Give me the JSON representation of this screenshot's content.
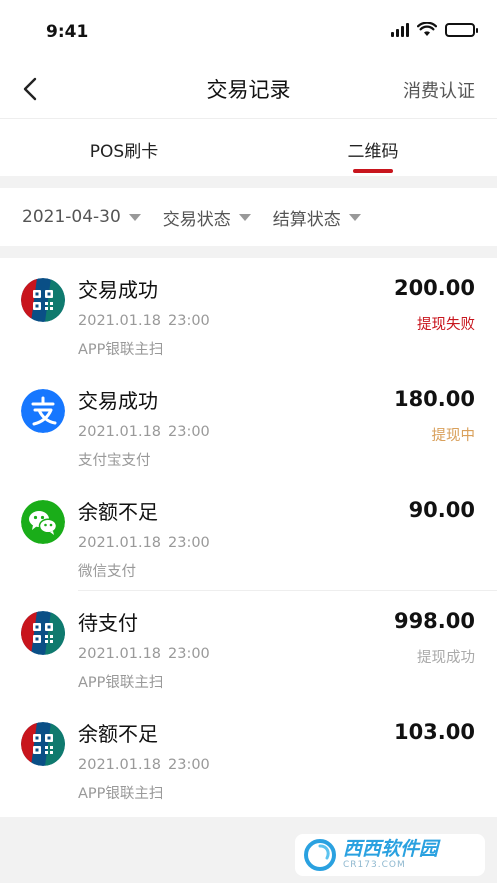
{
  "status_bar": {
    "time": "9:41"
  },
  "nav": {
    "title": "交易记录",
    "action": "消费认证"
  },
  "tabs": [
    {
      "label": "POS刷卡",
      "active": false
    },
    {
      "label": "二维码",
      "active": true
    }
  ],
  "accent_color": "#c8151d",
  "filters": [
    {
      "label": "2021-04-30"
    },
    {
      "label": "交易状态"
    },
    {
      "label": "结算状态"
    }
  ],
  "transactions": [
    {
      "status": "交易成功",
      "date": "2021.01.18",
      "time": "23:00",
      "method": "APP银联主扫",
      "amount": "200.00",
      "withdraw": "提现失败",
      "withdraw_color": "#c8151d",
      "icon": "unionpay-qr-icon"
    },
    {
      "status": "交易成功",
      "date": "2021.01.18",
      "time": "23:00",
      "method": "支付宝支付",
      "amount": "180.00",
      "withdraw": "提现中",
      "withdraw_color": "#d9a05b",
      "icon": "alipay-icon"
    },
    {
      "status": "余额不足",
      "date": "2021.01.18",
      "time": "23:00",
      "method": "微信支付",
      "amount": "90.00",
      "withdraw": "",
      "withdraw_color": "#999999",
      "icon": "wechat-icon"
    },
    {
      "status": "待支付",
      "date": "2021.01.18",
      "time": "23:00",
      "method": "APP银联主扫",
      "amount": "998.00",
      "withdraw": "提现成功",
      "withdraw_color": "#aaaaaa",
      "icon": "unionpay-qr-icon"
    },
    {
      "status": "余额不足",
      "date": "2021.01.18",
      "time": "23:00",
      "method": "APP银联主扫",
      "amount": "103.00",
      "withdraw": "",
      "withdraw_color": "#999999",
      "icon": "unionpay-qr-icon"
    }
  ],
  "watermark": {
    "main": "西西软件园",
    "sub": "CR173.COM"
  }
}
